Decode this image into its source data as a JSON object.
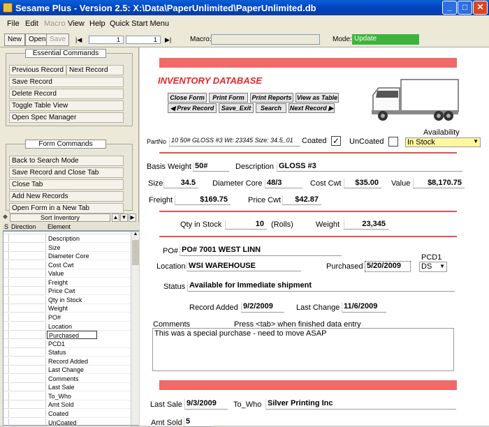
{
  "window": {
    "title": "Sesame Plus - Version 2.5: X:\\Data\\PaperUnlimited\\PaperUnlimited.db",
    "min": "_",
    "max": "□",
    "close": "✕"
  },
  "menu": [
    "File",
    "Edit",
    "Macro",
    "View",
    "Help",
    "Quick Start Menu"
  ],
  "toolbar": {
    "new": "New",
    "open": "Open",
    "save": "Save",
    "first": "|◀",
    "prev": "◀",
    "record_current": "1",
    "record_total": "1",
    "next": "▶",
    "last": "▶|",
    "macro_label": "Macro:",
    "macro_value": "",
    "mode_label": "Mode:",
    "mode_value": "Update"
  },
  "essential": {
    "title": "Essential Commands",
    "prev": "Previous Record",
    "next": "Next Record",
    "save": "Save Record",
    "delete": "Delete Record",
    "toggle": "Toggle Table View",
    "spec": "Open Spec Manager"
  },
  "formcmd": {
    "title": "Form Commands",
    "back": "Back to Search Mode",
    "saveclose": "Save Record and Close Tab",
    "closetab": "Close Tab",
    "addnew": "Add New Records",
    "openform": "Open Form in a New Tab"
  },
  "sort": {
    "title": "Sort Inventory",
    "col_s": "S",
    "col_direction": "Direction",
    "col_element": "Element",
    "items": [
      "Description",
      "Size",
      "Diameter Core",
      "Cost Cwt",
      "Value",
      "Freight",
      "Price Cwt",
      "Qty in Stock",
      "Weight",
      "PO#",
      "Location",
      "Purchased",
      "PCD1",
      "Status",
      "Record Added",
      "Last Change",
      "Comments",
      "Last Sale",
      "To_Who",
      "Amt Sold",
      "Coated",
      "UnCoated"
    ]
  },
  "form": {
    "title": "INVENTORY DATABASE",
    "buttons": {
      "close": "Close Form",
      "print": "Print Form",
      "reports": "Print Reports",
      "table": "View as Table",
      "prev": "◀ Prev Record",
      "saveexit": "Save_Exit",
      "search": "Search",
      "next": "Next Record ▶"
    },
    "partno_label": "PartNo",
    "partno": "10 50# GLOSS #3 Wt: 23345 Size: 34.5_01",
    "coated_label": "Coated",
    "coated_check": "✓",
    "uncoated_label": "UnCoated",
    "availability_label": "Availability",
    "availability": "In Stock",
    "basis_label": "Basis Weight",
    "basis": "50#",
    "desc_label": "Description",
    "desc": "GLOSS #3",
    "size_label": "Size",
    "size": "34.5",
    "diam_label": "Diameter Core",
    "diam": "48/3",
    "costcwt_label": "Cost Cwt",
    "costcwt": "$35.00",
    "value_label": "Value",
    "value": "$8,170.75",
    "freight_label": "Freight",
    "freight": "$169.75",
    "pricecwt_label": "Price Cwt",
    "pricecwt": "$42.87",
    "qty_label": "Qty in Stock",
    "qty": "10",
    "rolls": "(Rolls)",
    "weight_label": "Weight",
    "weight": "23,345",
    "po_label": "PO#",
    "po": "PO# 7001 WEST LINN",
    "pcd1_label": "PCD1",
    "location_label": "Location",
    "location": "WSI WAREHOUSE",
    "purchased_label": "Purchased",
    "purchased": "5/20/2009",
    "pcd1": "DS",
    "status_label": "Status",
    "status": "Available for Immediate shipment",
    "added_label": "Record Added",
    "added": "9/2/2009",
    "lastchange_label": "Last Change",
    "lastchange": "11/6/2009",
    "comments_label": "Comments",
    "comments_hint": "Press <tab> when finished data entry",
    "comments": "This was a special purchase - need to move ASAP",
    "lastsale_label": "Last Sale",
    "lastsale": "9/3/2009",
    "towho_label": "To_Who",
    "towho": "Silver Printing Inc",
    "amtsold_label": "Amt Sold",
    "amtsold": "5"
  }
}
